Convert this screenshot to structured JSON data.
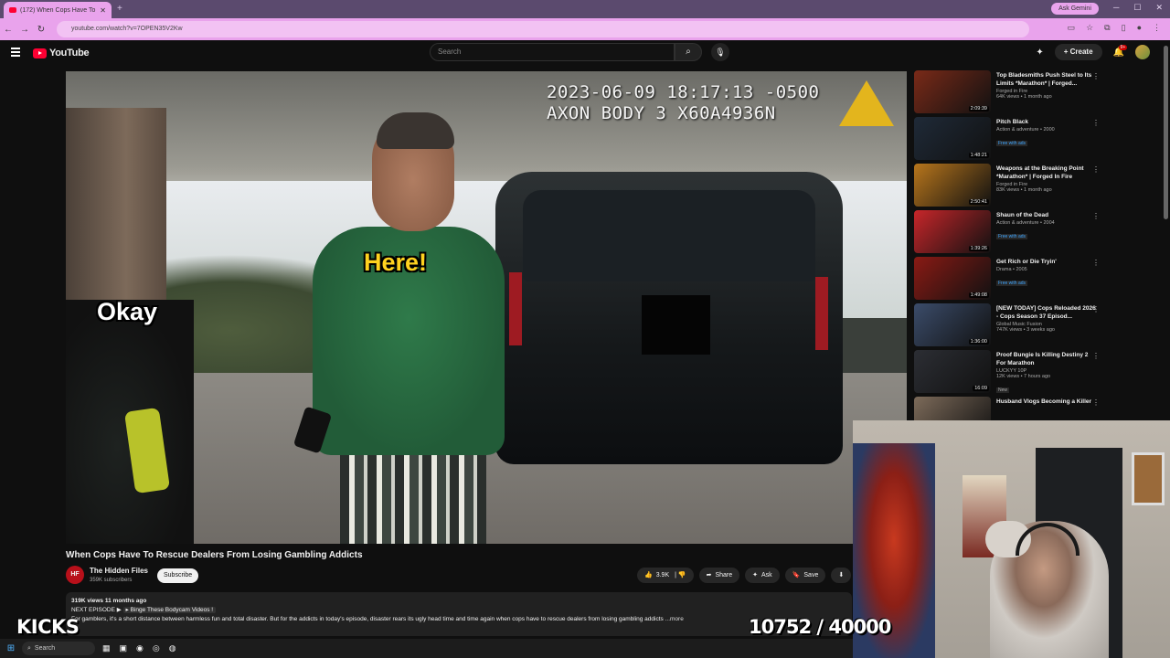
{
  "browser": {
    "tab_title": "(172) When Cops Have To R",
    "new_tab": "+",
    "ask_gemini": "Ask Gemini",
    "url": "youtube.com/watch?v=7OPEN35V2Kw"
  },
  "header": {
    "logo": "YouTube",
    "search_placeholder": "Search",
    "create_label": "Create",
    "notification_count": "9+"
  },
  "video": {
    "timestamp_line1": "2023-06-09 18:17:13 -0500",
    "timestamp_line2": "AXON BODY 3 X60A4936N",
    "caption_here": "Here!",
    "caption_okay": "Okay",
    "title": "When Cops Have To Rescue Dealers From Losing Gambling Addicts"
  },
  "channel": {
    "name": "The Hidden Files",
    "subscribers": "359K subscribers",
    "subscribe_label": "Subscribe",
    "avatar_text": "HF"
  },
  "actions": {
    "likes": "3.9K",
    "share": "Share",
    "ask": "Ask",
    "save": "Save"
  },
  "description": {
    "meta": "319K views  11 months ago",
    "next_episode": "NEXT EPISODE ▶",
    "playlist": "Binge These Bodycam Videos !",
    "text": "For gamblers, it's a short distance between harmless fun and total disaster. But for the addicts in today's episode, disaster rears its ugly head time and time again when cops have to rescue dealers from losing gambling addicts",
    "more": "...more"
  },
  "recommendations": [
    {
      "title": "Top Bladesmiths Push Steel to Its Limits *Marathon* | Forged...",
      "channel": "Forged in Fire",
      "meta": "64K views • 1 month ago",
      "duration": "2:09:39",
      "thumb_color": "#7a2a18"
    },
    {
      "title": "Pitch Black",
      "channel": "Action & adventure • 2000",
      "meta": "Free with ads",
      "duration": "1:48:21",
      "thumb_color": "#1f2a38"
    },
    {
      "title": "Weapons at the Breaking Point *Marathon* | Forged In Fire",
      "channel": "Forged in Fire",
      "meta": "83K views • 1 month ago",
      "duration": "2:50:41",
      "thumb_color": "#b8761c"
    },
    {
      "title": "Shaun of the Dead",
      "channel": "Action & adventure • 2004",
      "meta": "Free with ads",
      "duration": "1:39:26",
      "thumb_color": "#c7262a"
    },
    {
      "title": "Get Rich or Die Tryin'",
      "channel": "Drama • 2005",
      "meta": "Free with ads",
      "duration": "1:49:08",
      "thumb_color": "#8a1a14"
    },
    {
      "title": "[NEW TODAY] Cops Reloaded 2026 - Cops Season 37 Episod...",
      "channel": "Global Music Fusion",
      "meta": "747K views • 3 weeks ago",
      "duration": "1:36:00",
      "thumb_color": "#3b4c6a"
    },
    {
      "title": "Proof Bungie Is Killing Destiny 2 For Marathon",
      "channel": "LUCKYY 10P",
      "meta": "12K views • 7 hours ago",
      "duration": "16:09",
      "thumb_color": "#2c2e34",
      "badge": "New"
    },
    {
      "title": "Husband Vlogs Becoming a Killer",
      "channel": "",
      "meta": "",
      "duration": "",
      "thumb_color": "#7d6b5a"
    }
  ],
  "overlay": {
    "kicks": "KICKS",
    "counter": "10752 / 40000"
  },
  "taskbar": {
    "search": "Search"
  }
}
